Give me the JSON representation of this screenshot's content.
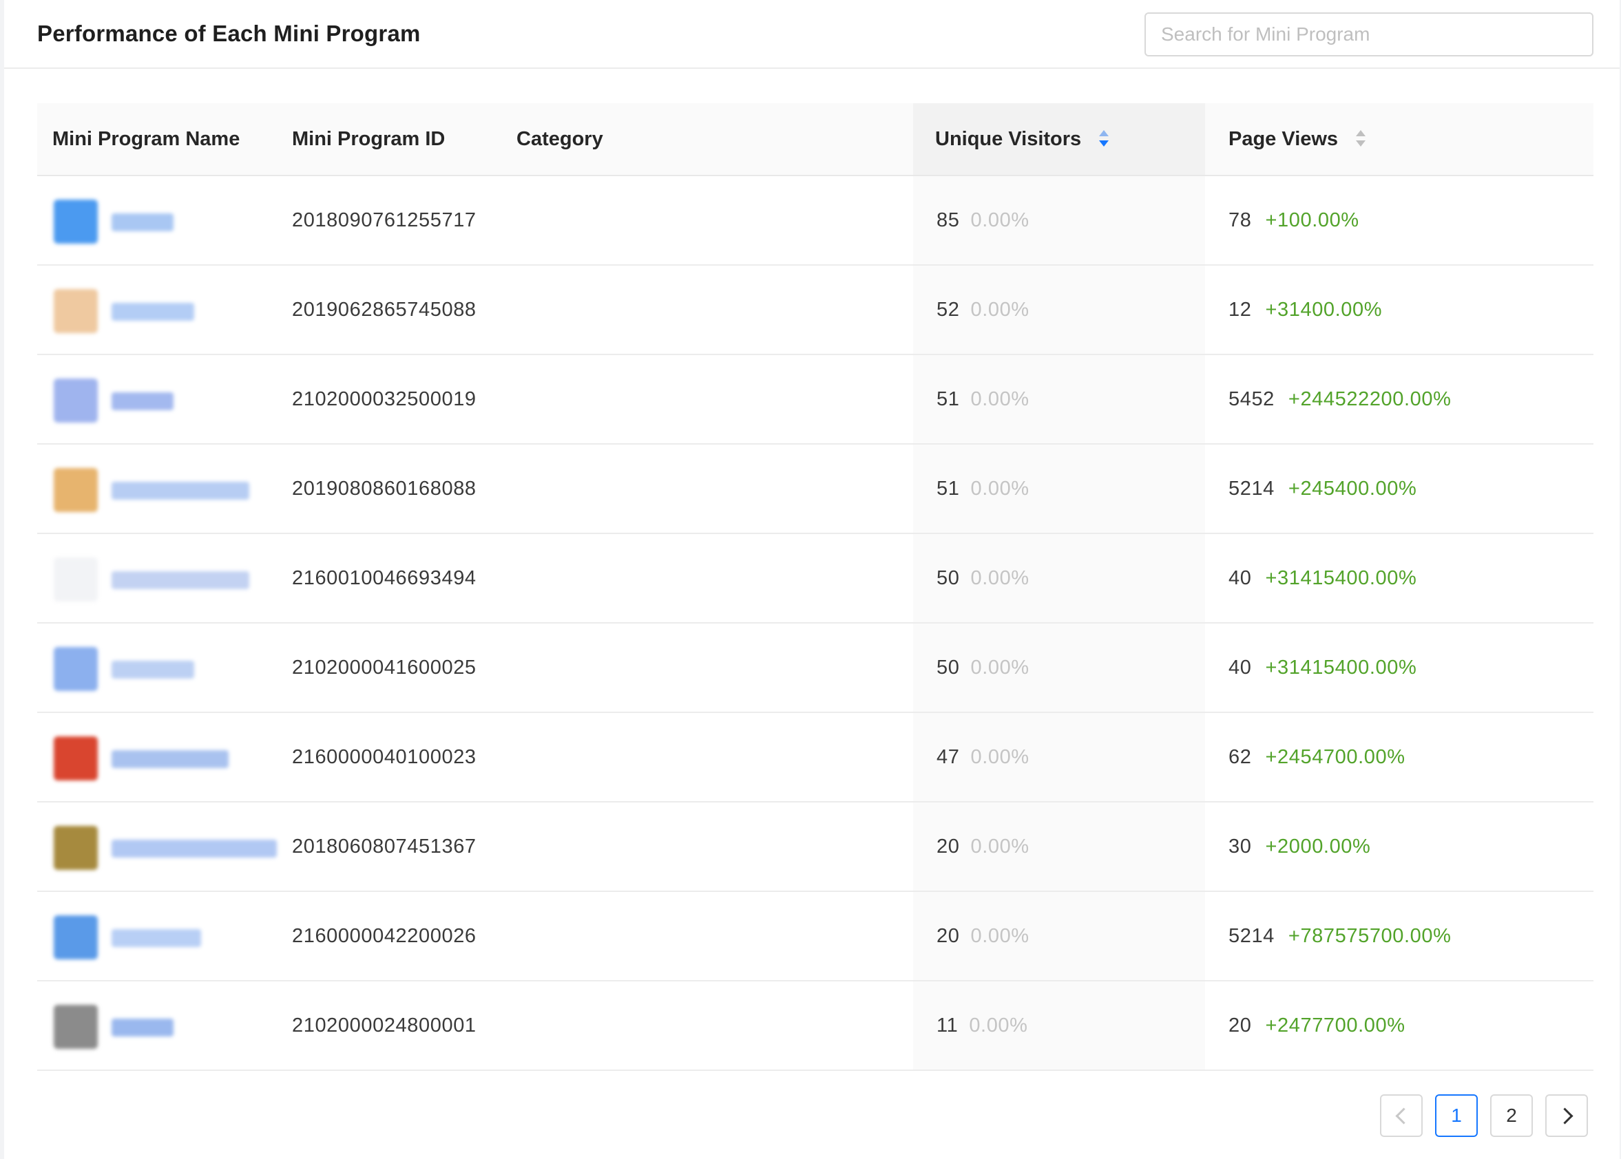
{
  "header": {
    "title": "Performance of Each Mini Program",
    "search_placeholder": "Search for Mini Program"
  },
  "table": {
    "columns": {
      "name": "Mini Program Name",
      "id": "Mini Program ID",
      "category": "Category",
      "visitors": "Unique Visitors",
      "views": "Page Views"
    },
    "sort": {
      "column": "visitors",
      "direction": "descending"
    },
    "rows": [
      {
        "id": "2018090761255717",
        "category": "",
        "visitors": "85",
        "visitors_change": "0.00%",
        "views": "78",
        "views_change": "+100.00%",
        "avatar_color": "#4b9af0",
        "name_color": "#a9c7f3"
      },
      {
        "id": "2019062865745088",
        "category": "",
        "visitors": "52",
        "visitors_change": "0.00%",
        "views": "12",
        "views_change": "+31400.00%",
        "avatar_color": "#efc9a0",
        "name_color": "#b3cdf5"
      },
      {
        "id": "2102000032500019",
        "category": "",
        "visitors": "51",
        "visitors_change": "0.00%",
        "views": "5452",
        "views_change": "+244522200.00%",
        "avatar_color": "#9fb4ee",
        "name_color": "#a3b9ef"
      },
      {
        "id": "2019080860168088",
        "category": "",
        "visitors": "51",
        "visitors_change": "0.00%",
        "views": "5214",
        "views_change": "+245400.00%",
        "avatar_color": "#e7b46e",
        "name_color": "#b7cdf3"
      },
      {
        "id": "2160010046693494",
        "category": "",
        "visitors": "50",
        "visitors_change": "0.00%",
        "views": "40",
        "views_change": "+31415400.00%",
        "avatar_color": "#f2f3f6",
        "name_color": "#c3d2f2"
      },
      {
        "id": "2102000041600025",
        "category": "",
        "visitors": "50",
        "visitors_change": "0.00%",
        "views": "40",
        "views_change": "+31415400.00%",
        "avatar_color": "#8cb0ee",
        "name_color": "#bcd0f3"
      },
      {
        "id": "2160000040100023",
        "category": "",
        "visitors": "47",
        "visitors_change": "0.00%",
        "views": "62",
        "views_change": "+2454700.00%",
        "avatar_color": "#d9452f",
        "name_color": "#a9c2ef"
      },
      {
        "id": "2018060807451367",
        "category": "",
        "visitors": "20",
        "visitors_change": "0.00%",
        "views": "30",
        "views_change": "+2000.00%",
        "avatar_color": "#a68a3e",
        "name_color": "#b1c8f3"
      },
      {
        "id": "2160000042200026",
        "category": "",
        "visitors": "20",
        "visitors_change": "0.00%",
        "views": "5214",
        "views_change": "+787575700.00%",
        "avatar_color": "#5a9ae8",
        "name_color": "#b8cff5"
      },
      {
        "id": "2102000024800001",
        "category": "",
        "visitors": "11",
        "visitors_change": "0.00%",
        "views": "20",
        "views_change": "+2477700.00%",
        "avatar_color": "#8b8b8b",
        "name_color": "#9ab8ee"
      }
    ]
  },
  "pagination": {
    "prev_icon": "chevron-left-icon",
    "next_icon": "chevron-right-icon",
    "pages": [
      "1",
      "2"
    ],
    "current": "1"
  }
}
